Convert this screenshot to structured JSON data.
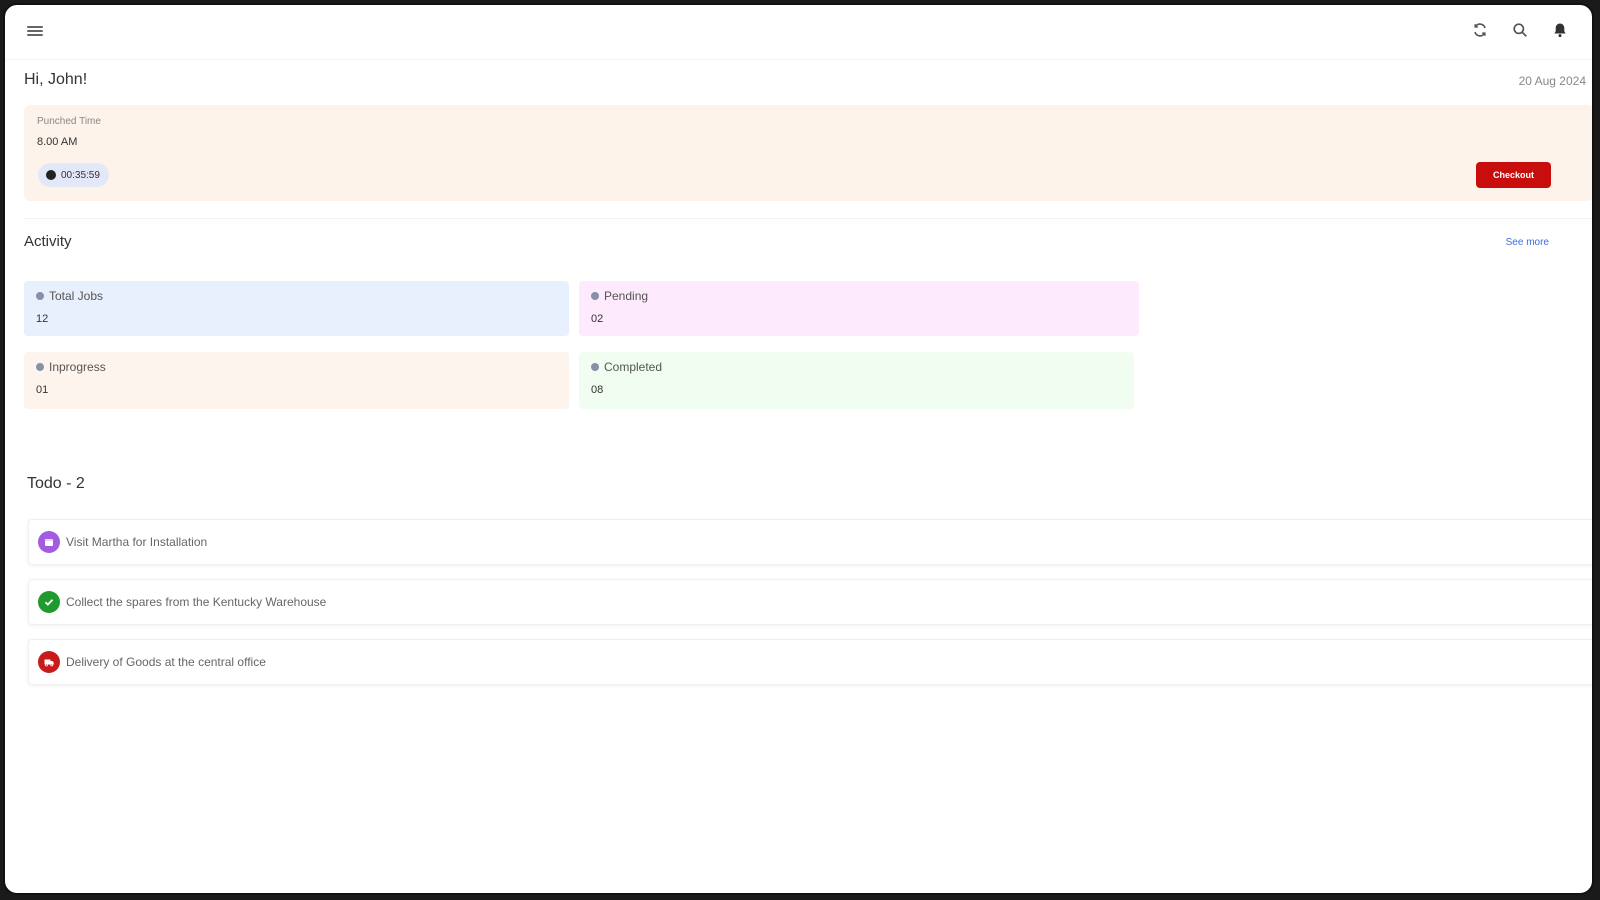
{
  "header": {
    "menu_icon": "menu-icon",
    "actions": [
      "refresh-icon",
      "search-icon",
      "bell-icon"
    ]
  },
  "greeting": "Hi, John!",
  "date": "20 Aug 2024",
  "punch": {
    "label": "Punched Time",
    "time": "8.00 AM",
    "timer": "00:35:59",
    "checkout_label": "Checkout"
  },
  "activity": {
    "title": "Activity",
    "see_more": "See more",
    "stats": [
      {
        "label": "Total Jobs",
        "value": "12"
      },
      {
        "label": "Pending",
        "value": "02"
      },
      {
        "label": "Inprogress",
        "value": "01"
      },
      {
        "label": "Completed",
        "value": "08"
      }
    ]
  },
  "todo": {
    "title": "Todo - 2",
    "items": [
      {
        "text": "Visit Martha for Installation",
        "icon": "calendar-icon",
        "color": "#a25ce0"
      },
      {
        "text": "Collect the spares from the Kentucky Warehouse",
        "icon": "check-icon",
        "color": "#1f9a2e"
      },
      {
        "text": "Delivery of Goods at the central office",
        "icon": "truck-icon",
        "color": "#c81c1c"
      }
    ]
  },
  "colors": {
    "checkout": "#c80d0d",
    "link": "#3b6de0",
    "punch_bg": "#fdf3ea"
  }
}
